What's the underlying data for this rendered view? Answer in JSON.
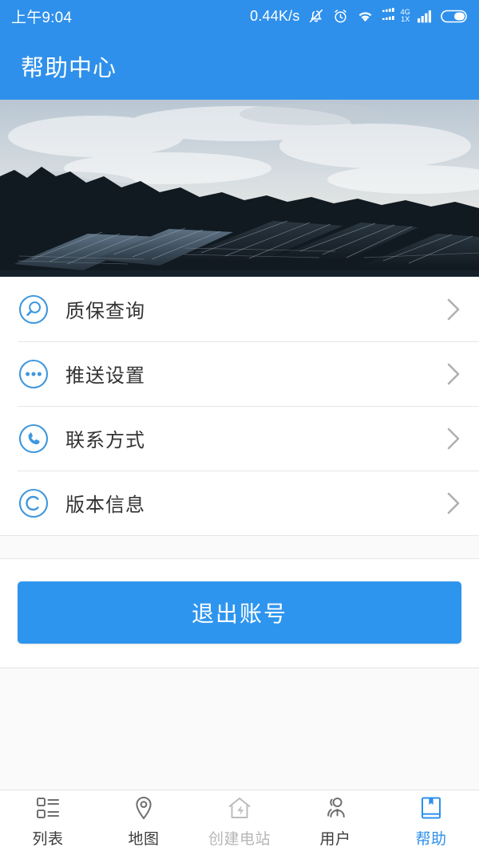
{
  "status_bar": {
    "time": "上午9:04",
    "net_speed": "0.44K/s",
    "icons": [
      "bell-muted-icon",
      "alarm-clock-icon",
      "wifi-icon",
      "signal-4g-icon",
      "signal-bars-icon",
      "battery-icon"
    ],
    "signal_labels": {
      "primary": "4G",
      "secondary": "1X"
    }
  },
  "header": {
    "title": "帮助中心",
    "background_color": "#2e90eb"
  },
  "banner": {
    "alt": "太阳能电站全景图",
    "sky_color": "#dfe6ea",
    "panel_color": "#1d2730"
  },
  "menu": {
    "items": [
      {
        "label": "质保查询",
        "icon": "search-circle-icon",
        "chevron": "chevron-right-icon"
      },
      {
        "label": "推送设置",
        "icon": "dots-circle-icon",
        "chevron": "chevron-right-icon"
      },
      {
        "label": "联系方式",
        "icon": "phone-circle-icon",
        "chevron": "chevron-right-icon"
      },
      {
        "label": "版本信息",
        "icon": "copyright-circle-icon",
        "chevron": "chevron-right-icon"
      }
    ],
    "icon_color": "#3f97dd"
  },
  "logout": {
    "label": "退出账号",
    "background_color": "#2e95ef"
  },
  "tabbar": {
    "items": [
      {
        "label": "列表",
        "icon": "list-icon",
        "state": "normal"
      },
      {
        "label": "地图",
        "icon": "map-pin-icon",
        "state": "normal"
      },
      {
        "label": "创建电站",
        "icon": "home-bolt-icon",
        "state": "disabled"
      },
      {
        "label": "用户",
        "icon": "users-info-icon",
        "state": "normal"
      },
      {
        "label": "帮助",
        "icon": "book-bookmark-icon",
        "state": "active"
      }
    ],
    "active_color": "#2e90eb",
    "disabled_color": "#b6b6b6"
  }
}
